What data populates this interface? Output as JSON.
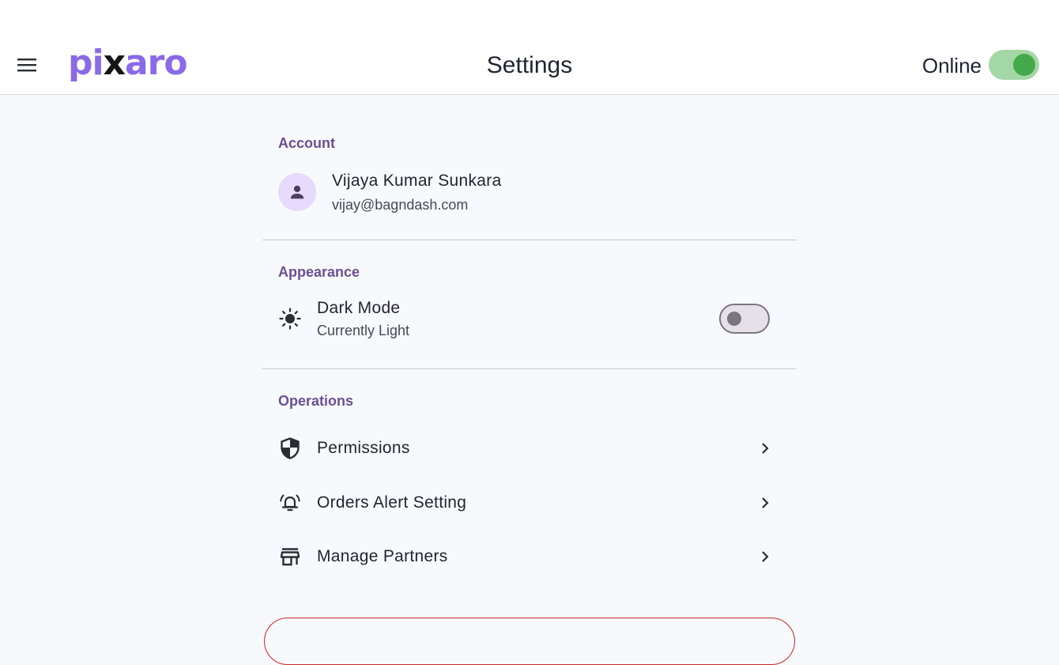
{
  "app_bar": {
    "menu_icon": "menu-icon",
    "logo": {
      "part1": "pi",
      "part2": "x",
      "part3": "aro"
    },
    "title": "Settings",
    "status_label": "Online",
    "status_on": true,
    "status_color": "#43a94a"
  },
  "account": {
    "section_title": "Account",
    "avatar_icon": "person-icon",
    "name": "Vijaya Kumar Sunkara",
    "email": "vijay@bagndash.com"
  },
  "appearance": {
    "section_title": "Appearance",
    "dark_mode": {
      "icon": "sun-icon",
      "title": "Dark Mode",
      "subtitle": "Currently Light",
      "enabled": false
    }
  },
  "operations": {
    "section_title": "Operations",
    "items": [
      {
        "icon": "shield-icon",
        "label": "Permissions"
      },
      {
        "icon": "alarm-bell-icon",
        "label": "Orders Alert Setting"
      },
      {
        "icon": "store-icon",
        "label": "Manage Partners"
      }
    ]
  },
  "colors": {
    "accent": "#8b6ae8",
    "section_title": "#6a4f92",
    "danger": "#c62828"
  }
}
